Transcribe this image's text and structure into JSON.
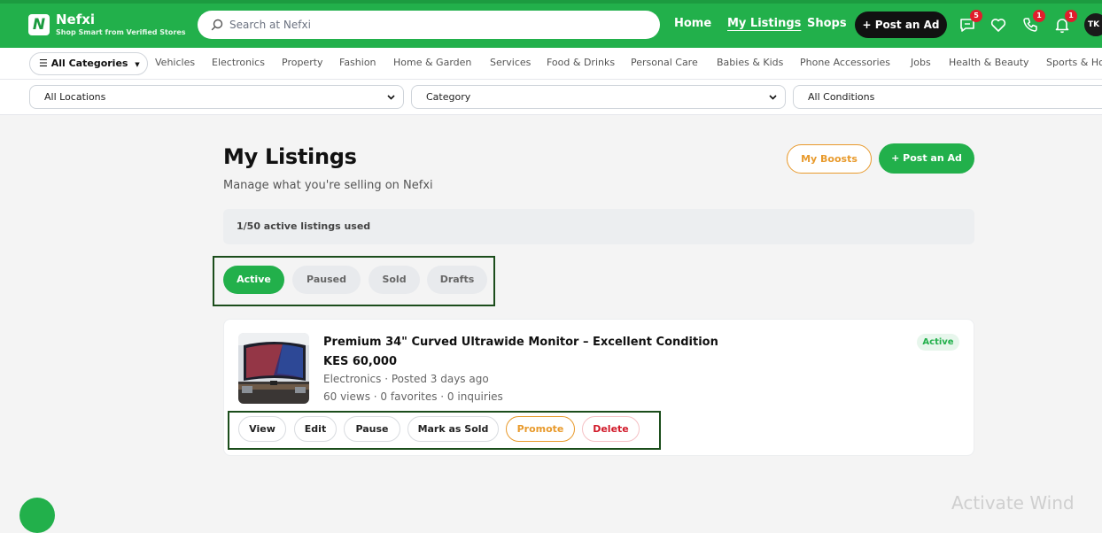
{
  "brand": {
    "logo_letter": "N",
    "name": "Nefxi",
    "tagline": "Shop Smart from Verified Stores",
    "color": "#22b04b"
  },
  "search": {
    "placeholder": "Search at Nefxi"
  },
  "topnav": {
    "home": "Home",
    "my_listings": "My Listings",
    "shops": "Shops",
    "post_ad": "+ Post an Ad",
    "messages_badge": "5",
    "calls_badge": "1",
    "notifications_badge": "1",
    "avatar_initials": "TK"
  },
  "categories": {
    "all_label": "All Categories",
    "items": [
      "Vehicles",
      "Electronics",
      "Property",
      "Fashion",
      "Home & Garden",
      "Services",
      "Food & Drinks",
      "Personal Care",
      "Babies & Kids",
      "Phone Accessories",
      "Jobs",
      "Health & Beauty",
      "Sports & Ho"
    ]
  },
  "filters": {
    "location": "All Locations",
    "category": "Category",
    "condition": "All Conditions"
  },
  "page": {
    "title": "My Listings",
    "subtitle": "Manage what you're selling on Nefxi",
    "boosts_button": "My Boosts",
    "post_button": "+ Post an Ad",
    "usage": "1/50 active listings used"
  },
  "tabs": {
    "active": "Active",
    "paused": "Paused",
    "sold": "Sold",
    "drafts": "Drafts"
  },
  "listing": {
    "title": "Premium 34\" Curved Ultrawide Monitor – Excellent Condition",
    "price": "KES 60,000",
    "meta": "Electronics · Posted 3 days ago",
    "stats": "60 views · 0 favorites · 0 inquiries",
    "status": "Active",
    "actions": {
      "view": "View",
      "edit": "Edit",
      "pause": "Pause",
      "mark_sold": "Mark as Sold",
      "promote": "Promote",
      "delete": "Delete"
    }
  },
  "watermark": "Activate Wind"
}
